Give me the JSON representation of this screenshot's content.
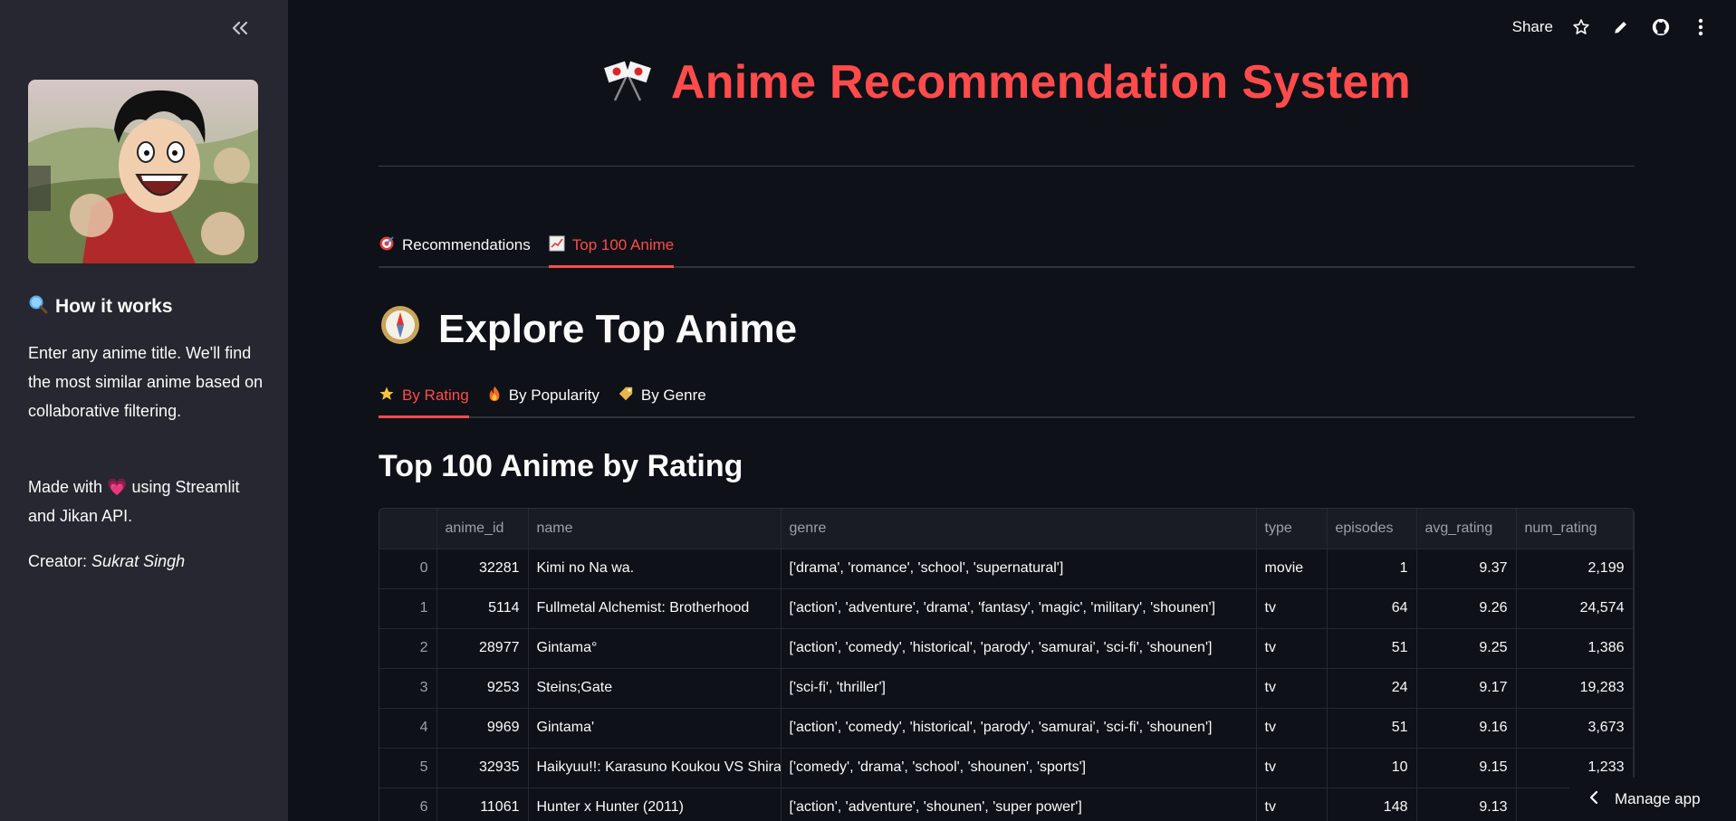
{
  "header": {
    "share_label": "Share",
    "icons": [
      "star-icon",
      "pencil-icon",
      "github-icon",
      "more-vertical-icon"
    ]
  },
  "sidebar": {
    "how_it_works": "How it works",
    "description": "Enter any anime title. We'll find the most similar anime based on collaborative filtering.",
    "made_with_prefix": "Made with",
    "made_with_suffix": "using Streamlit and Jikan API.",
    "creator_label": "Creator:",
    "creator_name": "Sukrat Singh"
  },
  "main": {
    "title": "Anime Recommendation System",
    "tabs": [
      {
        "label": "Recommendations",
        "icon": "target-icon",
        "active": false
      },
      {
        "label": "Top 100 Anime",
        "icon": "chart-icon",
        "active": true
      }
    ],
    "section_title": "Explore Top Anime",
    "subtabs": [
      {
        "label": "By Rating",
        "icon": "star-icon",
        "active": true
      },
      {
        "label": "By Popularity",
        "icon": "fire-icon",
        "active": false
      },
      {
        "label": "By Genre",
        "icon": "tag-icon",
        "active": false
      }
    ],
    "subtitle": "Top 100 Anime by Rating"
  },
  "table": {
    "columns": [
      "",
      "anime_id",
      "name",
      "genre",
      "type",
      "episodes",
      "avg_rating",
      "num_rating"
    ],
    "rows": [
      [
        "0",
        "32281",
        "Kimi no Na wa.",
        "['drama', 'romance', 'school', 'supernatural']",
        "movie",
        "1",
        "9.37",
        "2,199"
      ],
      [
        "1",
        "5114",
        "Fullmetal Alchemist: Brotherhood",
        "['action', 'adventure', 'drama', 'fantasy', 'magic', 'military', 'shounen']",
        "tv",
        "64",
        "9.26",
        "24,574"
      ],
      [
        "2",
        "28977",
        "Gintama°",
        "['action', 'comedy', 'historical', 'parody', 'samurai', 'sci-fi', 'shounen']",
        "tv",
        "51",
        "9.25",
        "1,386"
      ],
      [
        "3",
        "9253",
        "Steins;Gate",
        "['sci-fi', 'thriller']",
        "tv",
        "24",
        "9.17",
        "19,283"
      ],
      [
        "4",
        "9969",
        "Gintama'",
        "['action', 'comedy', 'historical', 'parody', 'samurai', 'sci-fi', 'shounen']",
        "tv",
        "51",
        "9.16",
        "3,673"
      ],
      [
        "5",
        "32935",
        "Haikyuu!!: Karasuno Koukou VS Shira",
        "['comedy', 'drama', 'school', 'shounen', 'sports']",
        "tv",
        "10",
        "9.15",
        "1,233"
      ],
      [
        "6",
        "11061",
        "Hunter x Hunter (2011)",
        "['action', 'adventure', 'shounen', 'super power']",
        "tv",
        "148",
        "9.13",
        ""
      ]
    ]
  },
  "footer": {
    "manage_app": "Manage app"
  }
}
